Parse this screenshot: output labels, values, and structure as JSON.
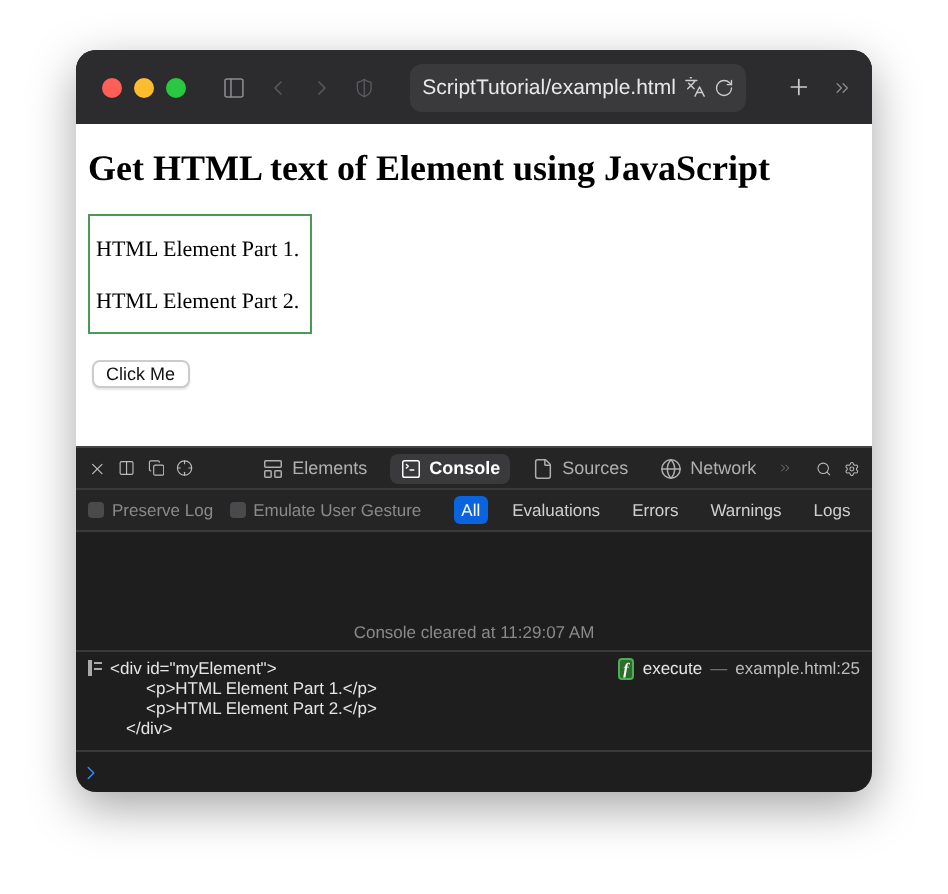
{
  "toolbar": {
    "address": "ScriptTutorial/example.html"
  },
  "page": {
    "heading": "Get HTML text of Element using JavaScript",
    "paragraphs": [
      "HTML Element Part 1.",
      "HTML Element Part 2."
    ],
    "button": "Click Me"
  },
  "devtools": {
    "tabs": [
      {
        "kind": "elements",
        "label": "Elements",
        "selected": false
      },
      {
        "kind": "console",
        "label": "Console",
        "selected": true
      },
      {
        "kind": "sources",
        "label": "Sources",
        "selected": false
      },
      {
        "kind": "network",
        "label": "Network",
        "selected": false
      }
    ],
    "checkboxes": [
      {
        "label": "Preserve Log",
        "checked": false
      },
      {
        "label": "Emulate User Gesture",
        "checked": false
      }
    ],
    "levels": [
      {
        "label": "All",
        "selected": true
      },
      {
        "label": "Evaluations",
        "selected": false
      },
      {
        "label": "Errors",
        "selected": false
      },
      {
        "label": "Warnings",
        "selected": false
      },
      {
        "label": "Logs",
        "selected": false
      }
    ]
  },
  "console": {
    "cleared": "Console cleared at 11:29:07 AM",
    "log": {
      "open": "<div id=\"myElement\">",
      "children": [
        "<p>HTML Element Part 1.</p>",
        "<p>HTML Element Part 2.</p>"
      ],
      "close": "</div>",
      "badge": "f",
      "function": "execute",
      "separator": "—",
      "source": "example.html:25"
    }
  }
}
